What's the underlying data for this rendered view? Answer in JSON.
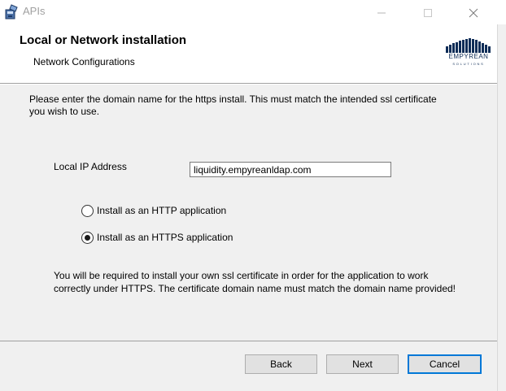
{
  "window": {
    "title": "APIs"
  },
  "header": {
    "title": "Local or Network installation",
    "subtitle": "Network Configurations",
    "logo_word": "EMPYREAN",
    "logo_sub": "SOLUTIONS"
  },
  "body": {
    "intro": "Please enter the domain name for the https install. This must match the intended ssl certificate you wish to use.",
    "ip_label": "Local IP Address",
    "ip_value": "liquidity.empyreanldap.com",
    "radio_http_label": "Install as an HTTP application",
    "radio_https_label": "Install as an HTTPS application",
    "selected_option": "https",
    "note": "You will be required to install your own ssl certificate in order for the application to work correctly under HTTPS. The certificate domain name must match the domain name provided!"
  },
  "buttons": {
    "back": "Back",
    "next": "Next",
    "cancel": "Cancel"
  },
  "colors": {
    "accent": "#0078d7",
    "logo": "#0f2d57"
  },
  "icons": {
    "app": "installer-icon",
    "minimize": "minimize-icon",
    "maximize": "maximize-icon",
    "close": "close-icon"
  }
}
